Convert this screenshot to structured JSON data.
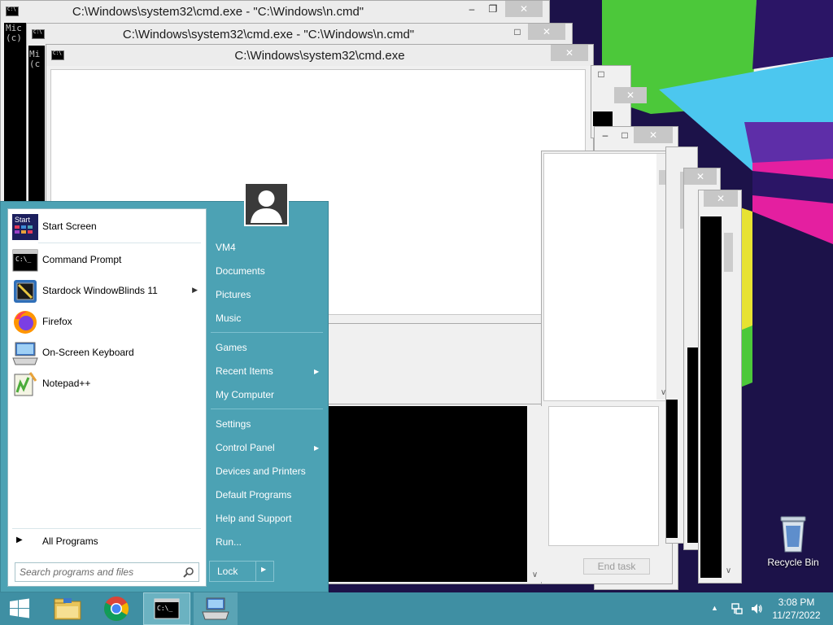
{
  "windows": [
    {
      "title": "C:\\Windows\\system32\\cmd.exe - \"C:\\Windows\\n.cmd\"",
      "console_lines": [
        "Mic",
        "(c)"
      ]
    },
    {
      "title": "C:\\Windows\\system32\\cmd.exe - \"C:\\Windows\\n.cmd\"",
      "console_lines": [
        "Mi",
        "(c"
      ]
    },
    {
      "title": "C:\\Windows\\system32\\cmd.exe"
    }
  ],
  "task_manager": {
    "end_task_label": "End task"
  },
  "start_menu": {
    "pinned": [
      {
        "label": "Start Screen",
        "icon": "start-screen-icon",
        "icon_text": "Start"
      },
      {
        "label": "Command Prompt",
        "icon": "command-prompt-icon",
        "icon_text": "C:\\_"
      }
    ],
    "recent": [
      {
        "label": "Stardock WindowBlinds 11",
        "icon": "windowblinds-icon",
        "has_submenu": true
      },
      {
        "label": "Firefox",
        "icon": "firefox-icon"
      },
      {
        "label": "On-Screen Keyboard",
        "icon": "keyboard-icon"
      },
      {
        "label": "Notepad++",
        "icon": "notepadpp-icon"
      }
    ],
    "all_programs_label": "All Programs",
    "search_placeholder": "Search programs and files",
    "right_items": [
      {
        "label": "VM4"
      },
      {
        "label": "Documents"
      },
      {
        "label": "Pictures"
      },
      {
        "label": "Music"
      },
      {
        "label": "Games"
      },
      {
        "label": "Recent Items",
        "has_submenu": true
      },
      {
        "label": "My Computer"
      },
      {
        "label": "Settings"
      },
      {
        "label": "Control Panel",
        "has_submenu": true
      },
      {
        "label": "Devices and Printers"
      },
      {
        "label": "Default Programs"
      },
      {
        "label": "Help and Support"
      },
      {
        "label": "Run..."
      }
    ],
    "lock_label": "Lock"
  },
  "desktop": {
    "recycle_bin_label": "Recycle Bin"
  },
  "taskbar": {
    "items": [
      "windows-start-icon",
      "file-explorer-icon",
      "chrome-icon",
      "command-prompt-icon",
      "on-screen-keyboard-icon"
    ],
    "tray": [
      "show-hidden-icons-icon",
      "network-icon",
      "volume-icon"
    ],
    "time": "3:08 PM",
    "date": "11/27/2022"
  },
  "colors": {
    "accent": "#4ca2b4",
    "taskbar": "#3f8fa3"
  }
}
